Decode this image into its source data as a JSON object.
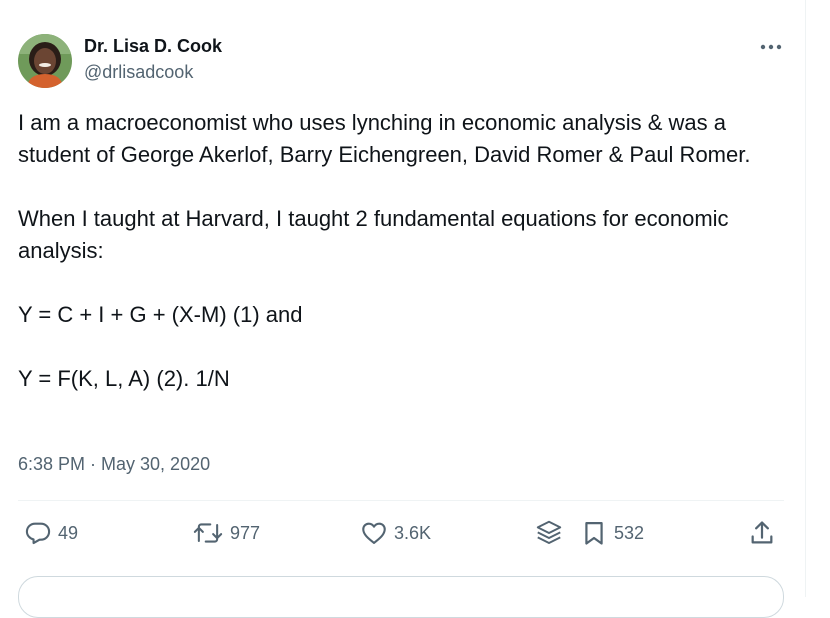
{
  "author": {
    "display_name": "Dr. Lisa D. Cook",
    "handle": "@drlisadcook",
    "avatar_icon": "user-avatar-photo"
  },
  "menu": {
    "more_icon": "more-options-icon"
  },
  "tweet": {
    "paragraphs": [
      "I am a macroeconomist who uses lynching in economic analysis & was a student of George Akerlof, Barry Eichengreen, David Romer & Paul Romer.",
      "When I taught at Harvard, I taught 2 fundamental equations for economic analysis:",
      "Y = C + I + G + (X-M) (1) and",
      "Y = F(K, L, A) (2). 1/N"
    ],
    "timestamp": "6:38 PM · May 30, 2020"
  },
  "actions": {
    "replies": "49",
    "retweets": "977",
    "likes": "3.6K",
    "bookmarks": "532"
  },
  "colors": {
    "text": "#0f1419",
    "secondary": "#536471",
    "divider": "#eff3f4"
  }
}
